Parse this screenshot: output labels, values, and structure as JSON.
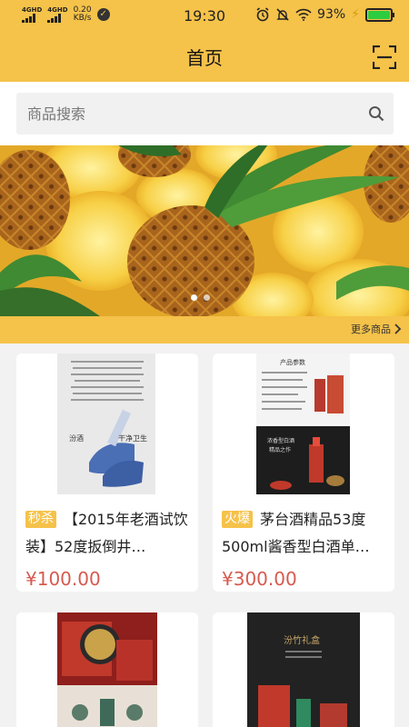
{
  "status_bar": {
    "network1": "4GHD",
    "network2": "4GHD",
    "speed_value": "0.20",
    "speed_unit": "KB/s",
    "time": "19:30",
    "battery": "93%"
  },
  "header": {
    "title": "首页"
  },
  "search": {
    "placeholder": "商品搜索"
  },
  "banner": {
    "slide_count": 2,
    "active_slide": 1
  },
  "more_label": "更多商品",
  "products": [
    {
      "tag": "秒杀",
      "name": "【2015年老酒试饮装】52度扳倒井…",
      "price": "¥100.00",
      "pic_text": [
        "汾酒",
        "干净卫生"
      ]
    },
    {
      "tag": "火爆",
      "name": "茅台酒精品53度500ml酱香型白酒单…",
      "price": "¥300.00",
      "pic_text": [
        "产品参数",
        "浓香型白酒",
        "精品之作"
      ]
    },
    {
      "pic_text": []
    },
    {
      "pic_text": [
        "汾竹礼盒"
      ]
    }
  ],
  "colors": {
    "accent": "#f5c24a",
    "price": "#d65a4f"
  }
}
